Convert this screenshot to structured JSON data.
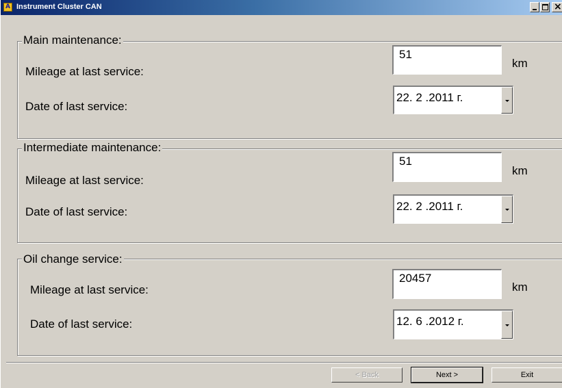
{
  "window": {
    "title": "Instrument Cluster CAN",
    "icon_letter": "A"
  },
  "sections": [
    {
      "legend": "Main maintenance:",
      "mileage_label": "Mileage at last service:",
      "mileage_value": "51",
      "unit": "km",
      "date_label": "Date of last service:",
      "date_value": "22. 2 .2011 г."
    },
    {
      "legend": "Intermediate maintenance:",
      "mileage_label": "Mileage at last service:",
      "mileage_value": "51",
      "unit": "km",
      "date_label": "Date of last service:",
      "date_value": "22. 2 .2011 г."
    },
    {
      "legend": "Oil change service:",
      "mileage_label": "Mileage at last service:",
      "mileage_value": "20457",
      "unit": "km",
      "date_label": "Date of last service:",
      "date_value": "12. 6 .2012 г."
    }
  ],
  "buttons": {
    "back": "< Back",
    "next": "Next >",
    "exit": "Exit"
  },
  "icons": {
    "app": "app-icon",
    "minimize": "minimize-icon",
    "maximize": "maximize-icon",
    "close": "close-icon",
    "dropdown": "chevron-down-icon"
  }
}
